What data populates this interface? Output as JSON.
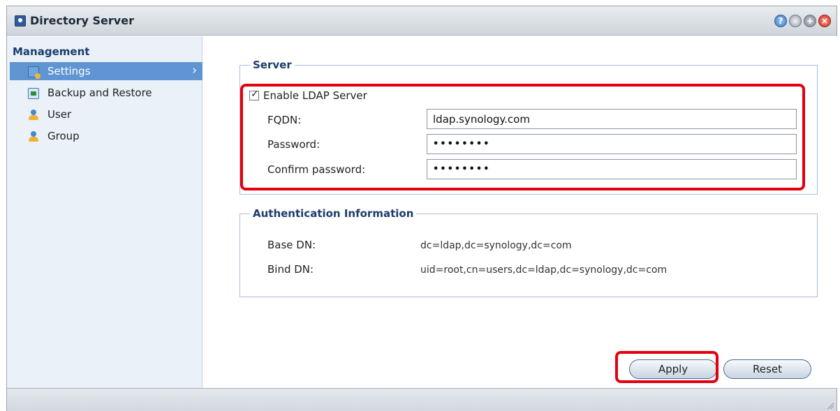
{
  "window": {
    "title": "Directory Server",
    "title_buttons": [
      "help-icon",
      "minimize-icon",
      "maximize-icon",
      "close-icon"
    ]
  },
  "sidebar": {
    "heading": "Management",
    "items": [
      {
        "label": "Settings",
        "icon": "settings-icon",
        "active": true
      },
      {
        "label": "Backup and Restore",
        "icon": "backup-icon",
        "active": false
      },
      {
        "label": "User",
        "icon": "user-icon",
        "active": false
      },
      {
        "label": "Group",
        "icon": "group-icon",
        "active": false
      }
    ]
  },
  "server": {
    "legend": "Server",
    "enable_label": "Enable LDAP Server",
    "enabled": true,
    "fqdn_label": "FQDN:",
    "fqdn_value": "ldap.synology.com",
    "password_label": "Password:",
    "password_value": "••••••••",
    "confirm_label": "Confirm password:",
    "confirm_value": "••••••••"
  },
  "auth": {
    "legend": "Authentication Information",
    "base_dn_label": "Base DN:",
    "base_dn_value": "dc=ldap,dc=synology,dc=com",
    "bind_dn_label": "Bind DN:",
    "bind_dn_value": "uid=root,cn=users,dc=ldap,dc=synology,dc=com"
  },
  "actions": {
    "apply_label": "Apply",
    "reset_label": "Reset"
  },
  "colors": {
    "highlight": "#e3000f",
    "active_nav": "#5f95d3",
    "legend_text": "#1a3d6b"
  }
}
